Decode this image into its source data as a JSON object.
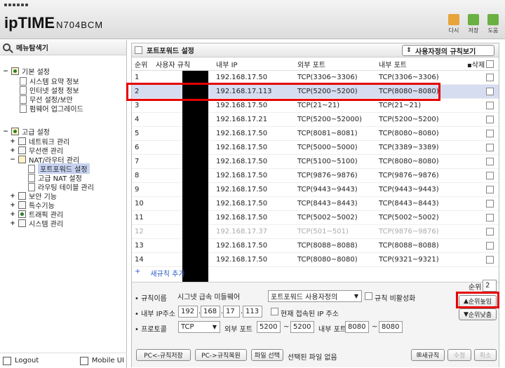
{
  "app": {
    "logo_main": "ipTIME",
    "logo_model": "N704BCM",
    "top_buttons": [
      {
        "label": "다시",
        "icon": "refresh-icon",
        "color": "#e8a33a"
      },
      {
        "label": "저장",
        "icon": "save-icon",
        "color": "#6bb043"
      },
      {
        "label": "도움",
        "icon": "help-icon",
        "color": "#6bb043"
      }
    ]
  },
  "sidebar": {
    "title": "메뉴탐색기",
    "basic": {
      "label": "기본 설정",
      "items": [
        "시스템 요약 정보",
        "인터넷 설정 정보",
        "무선 설정/보안",
        "펌웨어 업그레이드"
      ]
    },
    "advanced": {
      "label": "고급 설정",
      "items": [
        "네트워크 관리",
        "무선랜 관리",
        "NAT/라우터 관리"
      ],
      "nat_items": [
        "포트포워드 설정",
        "고급 NAT 설정",
        "라우팅 테이블 관리"
      ],
      "after_items": [
        "보안 기능",
        "특수기능",
        "트래픽 관리",
        "시스템 관리"
      ]
    },
    "logout": "Logout",
    "mobile_ui": "Mobile UI"
  },
  "panel": {
    "title": "포트포워드 설정",
    "sort_button": "사용자정의 규칙보기",
    "columns": [
      "순위",
      "사용자 규칙",
      "내부 IP",
      "외부 포트",
      "내부 포트",
      "삭제"
    ],
    "rows": [
      {
        "rank": "1",
        "ip": "192.168.17.50",
        "ext": "TCP(3306~3306)",
        "int": "TCP(3306~3306)"
      },
      {
        "rank": "2",
        "ip": "192.168.17.113",
        "ext": "TCP(5200~5200)",
        "int": "TCP(8080~8080)"
      },
      {
        "rank": "3",
        "ip": "192.168.17.50",
        "ext": "TCP(21~21)",
        "int": "TCP(21~21)"
      },
      {
        "rank": "4",
        "ip": "192.168.17.21",
        "ext": "TCP(5200~52000)",
        "int": "TCP(5200~5200)"
      },
      {
        "rank": "5",
        "ip": "192.168.17.50",
        "ext": "TCP(8081~8081)",
        "int": "TCP(8080~8080)"
      },
      {
        "rank": "6",
        "ip": "192.168.17.50",
        "ext": "TCP(5000~5000)",
        "int": "TCP(3389~3389)"
      },
      {
        "rank": "7",
        "ip": "192.168.17.50",
        "ext": "TCP(5100~5100)",
        "int": "TCP(8080~8080)"
      },
      {
        "rank": "8",
        "ip": "192.168.17.50",
        "ext": "TCP(9876~9876)",
        "int": "TCP(9876~9876)"
      },
      {
        "rank": "9",
        "ip": "192.168.17.50",
        "ext": "TCP(9443~9443)",
        "int": "TCP(9443~9443)"
      },
      {
        "rank": "10",
        "ip": "192.168.17.50",
        "ext": "TCP(8443~8443)",
        "int": "TCP(8443~8443)"
      },
      {
        "rank": "11",
        "ip": "192.168.17.50",
        "ext": "TCP(5002~5002)",
        "int": "TCP(5002~5002)"
      },
      {
        "rank": "12",
        "ip": "192.168.17.37",
        "ext": "TCP(501~501)",
        "int": "TCP(9876~9876)"
      },
      {
        "rank": "13",
        "ip": "192.168.17.50",
        "ext": "TCP(8088~8088)",
        "int": "TCP(8088~8088)"
      },
      {
        "rank": "14",
        "ip": "192.168.17.50",
        "ext": "TCP(8080~8080)",
        "int": "TCP(9321~9321)"
      }
    ],
    "add_plus": "+",
    "add_rule": "새규칙 추가"
  },
  "form": {
    "rule_name_label": "규칙이름",
    "rule_name_value": "시그넷 급속 미들웨어",
    "rule_select": "포트포워드 사용자정의",
    "disable_label": "규칙 비활성화",
    "ip_label": "내부 IP주소",
    "ip": [
      "192",
      "168",
      "17",
      "113"
    ],
    "current_ip_label": "현재 접속된 IP 주소",
    "protocol_label": "프로토콜",
    "protocol_value": "TCP",
    "ext_port_label": "외부 포트",
    "ext_from": "5200",
    "ext_to": "5200",
    "tilde": "~",
    "int_port_label": "내부 포트",
    "int_from": "8080",
    "int_to": "8080",
    "rank_label": "순위",
    "rank_value": "2",
    "rank_up": "순위높임",
    "rank_down": "순위낮춤",
    "save_pc": "PC<-규칙저장",
    "restore_pc": "PC->규칙복원",
    "file_choose": "파일 선택",
    "file_none": "선택된 파일 없음",
    "new_rule": "새규칙",
    "modify": "수정",
    "cancel": "취소"
  }
}
